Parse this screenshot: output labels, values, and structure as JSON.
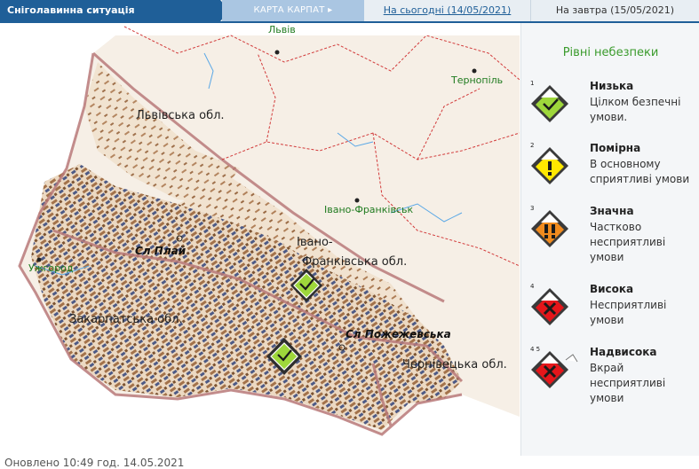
{
  "tabs": {
    "active": "Сніголавинна ситуація",
    "map": "КАРТА КАРПАТ",
    "today": "На сьогодні (14/05/2021)",
    "tomorrow": "На завтра (15/05/2021)"
  },
  "map": {
    "regions": {
      "lviv": "Львівська обл.",
      "ivano1": "Івано-",
      "ivano2": "Франківська обл.",
      "zakarpattia": "Закарпатська обл.",
      "chernivtsi": "Чернівецька обл."
    },
    "cities": {
      "lviv": "Львів",
      "ternopil": "Тернопіль",
      "ivano": "Івано-Франківськ",
      "uzhhorod": "Ужгород"
    },
    "ridges": {
      "plai": "Сл Плай",
      "pozhezhevska": "Сл Пожежевська"
    },
    "updated": "Оновлено 10:49 год. 14.05.2021"
  },
  "legend": {
    "title": "Рівні небезпеки",
    "levels": [
      {
        "num": "1",
        "name": "Низька",
        "desc": "Цілком безпечні умови.",
        "color": "#9ed73b",
        "icon": "check-icon"
      },
      {
        "num": "2",
        "name": "Помірна",
        "desc": "В основному сприятливі умови",
        "color": "#ffe800",
        "icon": "exclamation-icon"
      },
      {
        "num": "3",
        "name": "Значна",
        "desc": "Частково несприятливі умови",
        "color": "#f18b1e",
        "icon": "double-exclamation-icon"
      },
      {
        "num": "4",
        "name": "Висока",
        "desc": "Несприятливі умови",
        "color": "#e4161b",
        "icon": "cross-icon"
      },
      {
        "num": "4 5",
        "name": "Надвисока",
        "desc": "Вкрай несприятливі умови",
        "color": "#e4161b",
        "icon": "cross-icon"
      }
    ]
  }
}
